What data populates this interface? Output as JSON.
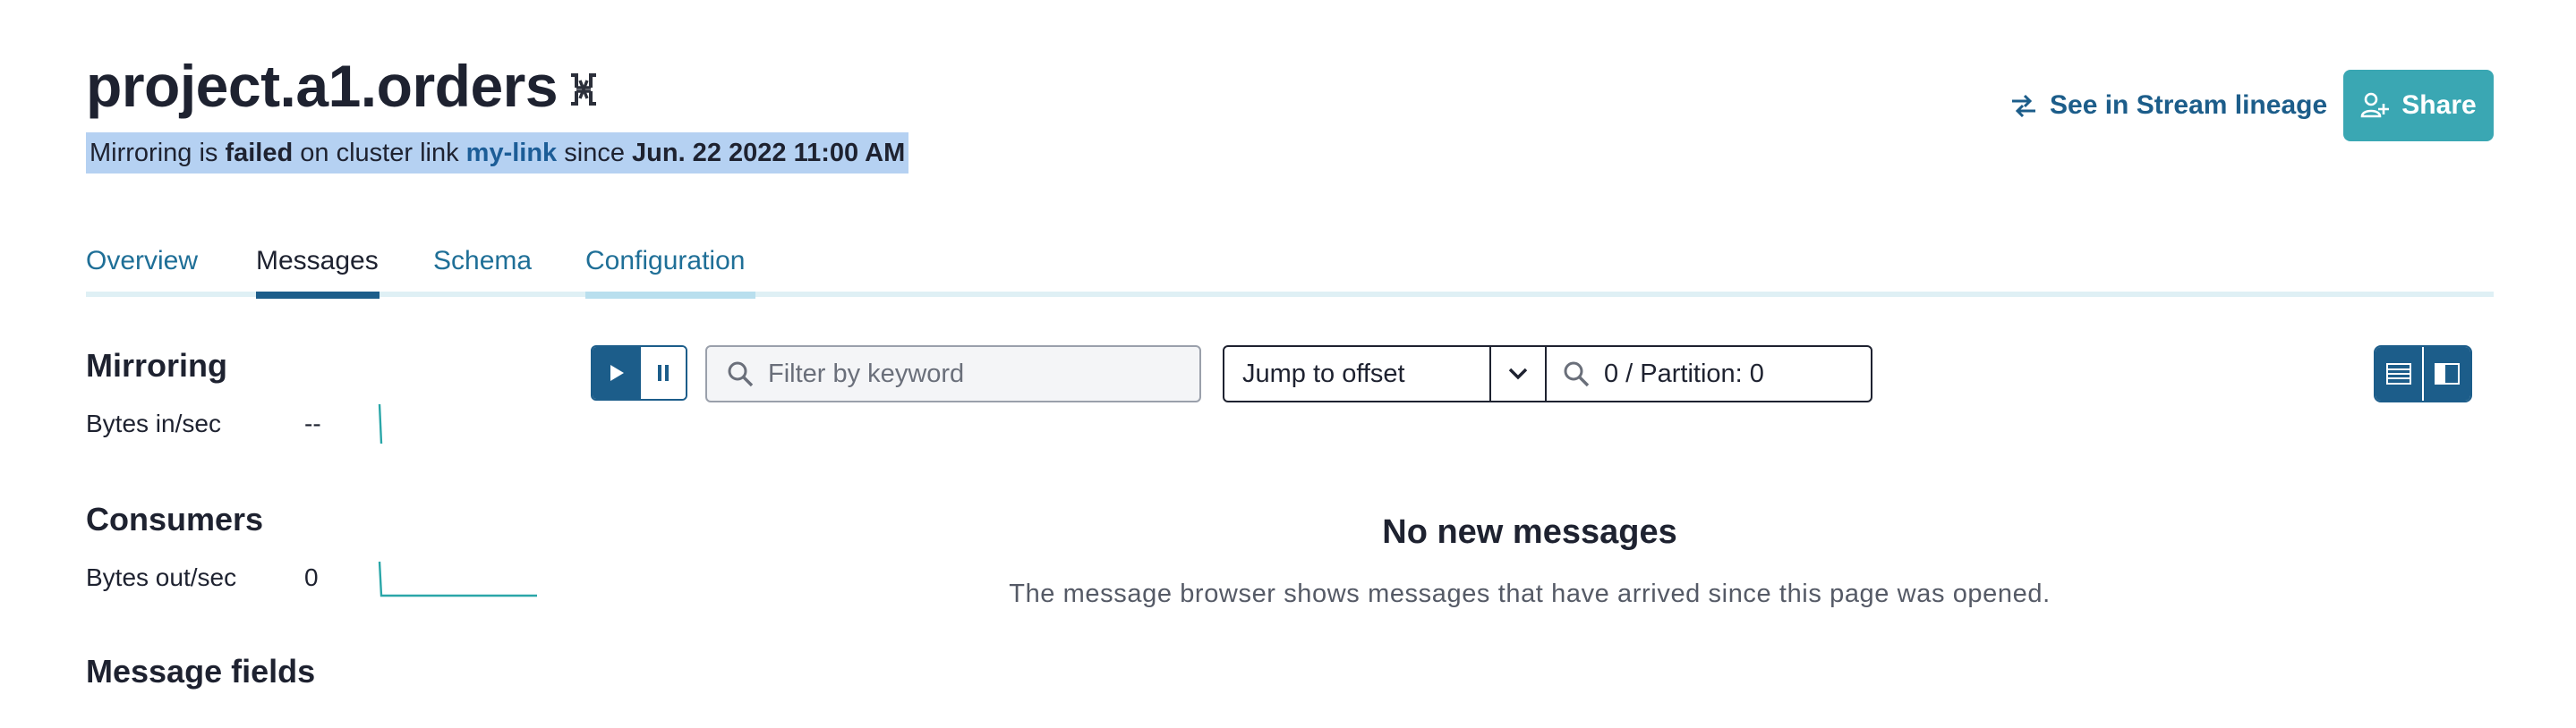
{
  "header": {
    "title": "project.a1.orders",
    "status": {
      "prefix": "Mirroring is",
      "state": "failed",
      "middle": "on cluster link",
      "link": "my-link",
      "since_word": "since",
      "since": "Jun. 22 2022 11:00 AM"
    },
    "lineage_label": "See in Stream lineage",
    "share_label": "Share"
  },
  "tabs": [
    {
      "label": "Overview",
      "active": false
    },
    {
      "label": "Messages",
      "active": true
    },
    {
      "label": "Schema",
      "active": false
    },
    {
      "label": "Configuration",
      "active": false
    }
  ],
  "sidebar": {
    "mirroring": {
      "heading": "Mirroring",
      "metric_label": "Bytes in/sec",
      "metric_value": "--"
    },
    "consumers": {
      "heading": "Consumers",
      "metric_label": "Bytes out/sec",
      "metric_value": "0"
    },
    "message_fields": {
      "heading": "Message fields"
    }
  },
  "toolbar": {
    "filter_placeholder": "Filter by keyword",
    "offset_mode": "Jump to offset",
    "offset_value": "0 / Partition: 0"
  },
  "empty_state": {
    "heading": "No new messages",
    "description": "The message browser shows messages that have arrived since this page was opened."
  },
  "colors": {
    "accent": "#1c5d8a",
    "share": "#3aa7b3",
    "sparkline": "#2aa6a8",
    "highlight": "#b5d1f2"
  }
}
